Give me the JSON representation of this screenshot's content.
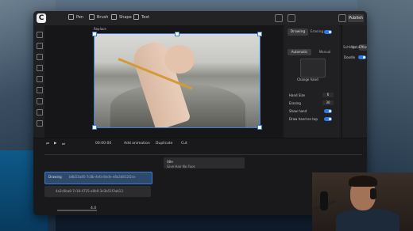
{
  "toolbar": {
    "tools": [
      "Pen",
      "Brush",
      "Shape",
      "Text"
    ],
    "publish_label": "Publish"
  },
  "canvas": {
    "scene_label": "Replace"
  },
  "properties": {
    "mode_tabs": [
      "Drawing",
      "Erasing"
    ],
    "style_tabs": [
      "Automatic",
      "Manual"
    ],
    "hand_thumb_label": "Change hand",
    "hand_size_label": "Hand Size",
    "hand_size_value": "6",
    "erasing_label": "Erasing",
    "erasing_value": "30",
    "show_hand_label": "Show hand",
    "draw_hand_on_top_label": "Draw hand on top"
  },
  "right_panel": {
    "tabs": [
      "Settings",
      "Motion",
      "Effects"
    ],
    "doodle_label": "Doodle"
  },
  "timeline": {
    "timecode": "00:00:00",
    "add_animation": "Add animation",
    "duplicate": "Duplicate",
    "cut": "Cut",
    "clips": [
      {
        "title": "title",
        "subtitle": "Give Hair No Face"
      },
      {
        "title": "Drawing",
        "subtitle": "b8b53a46-7c8b-4efa-8ede-e8a3d812f2ce"
      },
      {
        "title": "",
        "subtitle": "4a2c6ba8-7c18-4725-a0b9-3e3b51f3ab13"
      }
    ],
    "zoom_value": "4.0"
  },
  "colors": {
    "accent": "#2f7be6",
    "drawing_clip": "#2b4a6e"
  }
}
